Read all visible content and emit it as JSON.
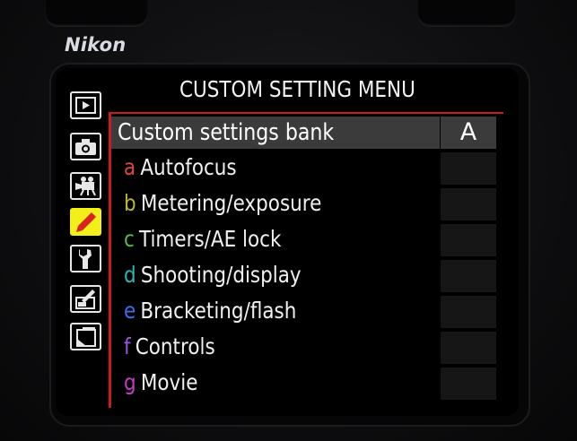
{
  "camera": {
    "brand": "Nikon"
  },
  "menu": {
    "title": "CUSTOM SETTING MENU",
    "bank": {
      "label": "Custom settings bank",
      "value": "A"
    },
    "items": [
      {
        "letter": "a",
        "label": "Autofocus",
        "color": "#e0453b"
      },
      {
        "letter": "b",
        "label": "Metering/exposure",
        "color": "#b9b33a"
      },
      {
        "letter": "c",
        "label": "Timers/AE lock",
        "color": "#4fbf46"
      },
      {
        "letter": "d",
        "label": "Shooting/display",
        "color": "#2cb6b0"
      },
      {
        "letter": "e",
        "label": "Bracketing/flash",
        "color": "#3d6fe8"
      },
      {
        "letter": "f",
        "label": "Controls",
        "color": "#9b55e0"
      },
      {
        "letter": "g",
        "label": "Movie",
        "color": "#c23cc8"
      }
    ]
  },
  "side_tabs": [
    {
      "icon": "playback-icon",
      "active": false
    },
    {
      "icon": "camera-icon",
      "active": false
    },
    {
      "icon": "movie-camera-icon",
      "active": false
    },
    {
      "icon": "pencil-icon",
      "active": true
    },
    {
      "icon": "wrench-icon",
      "active": false
    },
    {
      "icon": "retouch-icon",
      "active": false
    },
    {
      "icon": "recent-settings-icon",
      "active": false
    }
  ],
  "colors": {
    "accent_red": "#c81b1b",
    "active_tab": "#f4ee1b",
    "highlight_row": "#3b3b3b"
  }
}
